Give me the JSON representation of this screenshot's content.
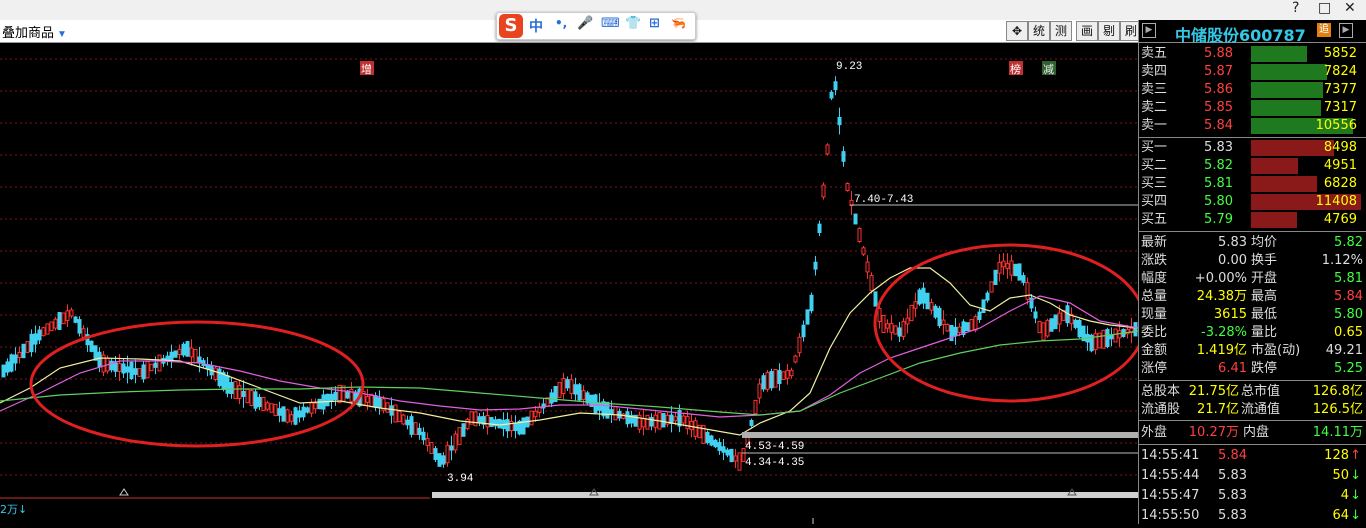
{
  "toolbar": {
    "overlay_label": "叠加商品",
    "overlay_arrow": "▼",
    "window_controls": [
      "?",
      "□",
      "✕"
    ],
    "buttons": [
      "统",
      "测",
      "画",
      "剔",
      "刷"
    ]
  },
  "ime": {
    "logo": "S",
    "items": [
      "中",
      "•,",
      "🎤",
      "⌨",
      "👕",
      "⊞",
      "🦐"
    ]
  },
  "chart": {
    "markers": {
      "zeng": "增",
      "bang": "榜",
      "jian": "减"
    },
    "labels": {
      "high": "9.23",
      "low": "3.94",
      "range1": "7.40-7.43",
      "range2": "4.53-4.59",
      "range3": "4.34-4.35"
    },
    "volume_label": "2万↓"
  },
  "stock": {
    "name": "中储股份600787",
    "badge": "追"
  },
  "asks": [
    {
      "label": "卖五",
      "price": "5.88",
      "vol": "5852",
      "frac": 0.51
    },
    {
      "label": "卖四",
      "price": "5.87",
      "vol": "7824",
      "frac": 0.69
    },
    {
      "label": "卖三",
      "price": "5.86",
      "vol": "7377",
      "frac": 0.65
    },
    {
      "label": "卖二",
      "price": "5.85",
      "vol": "7317",
      "frac": 0.64
    },
    {
      "label": "卖一",
      "price": "5.84",
      "vol": "10556",
      "frac": 0.93
    }
  ],
  "bids": [
    {
      "label": "买一",
      "price": "5.83",
      "vol": "8498",
      "frac": 0.75
    },
    {
      "label": "买二",
      "price": "5.82",
      "vol": "4951",
      "frac": 0.43
    },
    {
      "label": "买三",
      "price": "5.81",
      "vol": "6828",
      "frac": 0.6
    },
    {
      "label": "买四",
      "price": "5.80",
      "vol": "11408",
      "frac": 1.0
    },
    {
      "label": "买五",
      "price": "5.79",
      "vol": "4769",
      "frac": 0.42
    }
  ],
  "quote": [
    {
      "l1": "最新",
      "v1": "5.83",
      "c1": "white",
      "l2": "均价",
      "v2": "5.82",
      "c2": "green"
    },
    {
      "l1": "涨跌",
      "v1": "0.00",
      "c1": "white",
      "l2": "换手",
      "v2": "1.12%",
      "c2": "white"
    },
    {
      "l1": "幅度",
      "v1": "+0.00%",
      "c1": "white",
      "l2": "开盘",
      "v2": "5.81",
      "c2": "green"
    },
    {
      "l1": "总量",
      "v1": "24.38万",
      "c1": "yellow",
      "l2": "最高",
      "v2": "5.84",
      "c2": "red"
    },
    {
      "l1": "现量",
      "v1": "3615",
      "c1": "yellow",
      "l2": "最低",
      "v2": "5.80",
      "c2": "green"
    },
    {
      "l1": "委比",
      "v1": "-3.28%",
      "c1": "green",
      "l2": "量比",
      "v2": "0.65",
      "c2": "yellow"
    },
    {
      "l1": "金额",
      "v1": "1.419亿",
      "c1": "yellow",
      "l2": "市盈(动)",
      "v2": "49.21",
      "c2": "white"
    },
    {
      "l1": "涨停",
      "v1": "6.41",
      "c1": "red",
      "l2": "跌停",
      "v2": "5.25",
      "c2": "green"
    }
  ],
  "capital": [
    {
      "l1": "总股本",
      "v1": "21.75亿",
      "l2": "总市值",
      "v2": "126.8亿"
    },
    {
      "l1": "流通股",
      "v1": "21.7亿",
      "l2": "流通值",
      "v2": "126.5亿"
    }
  ],
  "outin": {
    "out_label": "外盘",
    "out_val": "10.27万",
    "in_label": "内盘",
    "in_val": "14.11万"
  },
  "ticks": [
    {
      "time": "14:55:41",
      "price": "5.84",
      "pc": "red",
      "vol": "128",
      "dir": "↑",
      "dc": "red"
    },
    {
      "time": "14:55:44",
      "price": "5.83",
      "pc": "white",
      "vol": "50",
      "dir": "↓",
      "dc": "green"
    },
    {
      "time": "14:55:47",
      "price": "5.83",
      "pc": "white",
      "vol": "4",
      "dir": "↓",
      "dc": "green"
    },
    {
      "time": "14:55:50",
      "price": "5.83",
      "pc": "white",
      "vol": "64",
      "dir": "↓",
      "dc": "green"
    }
  ]
}
